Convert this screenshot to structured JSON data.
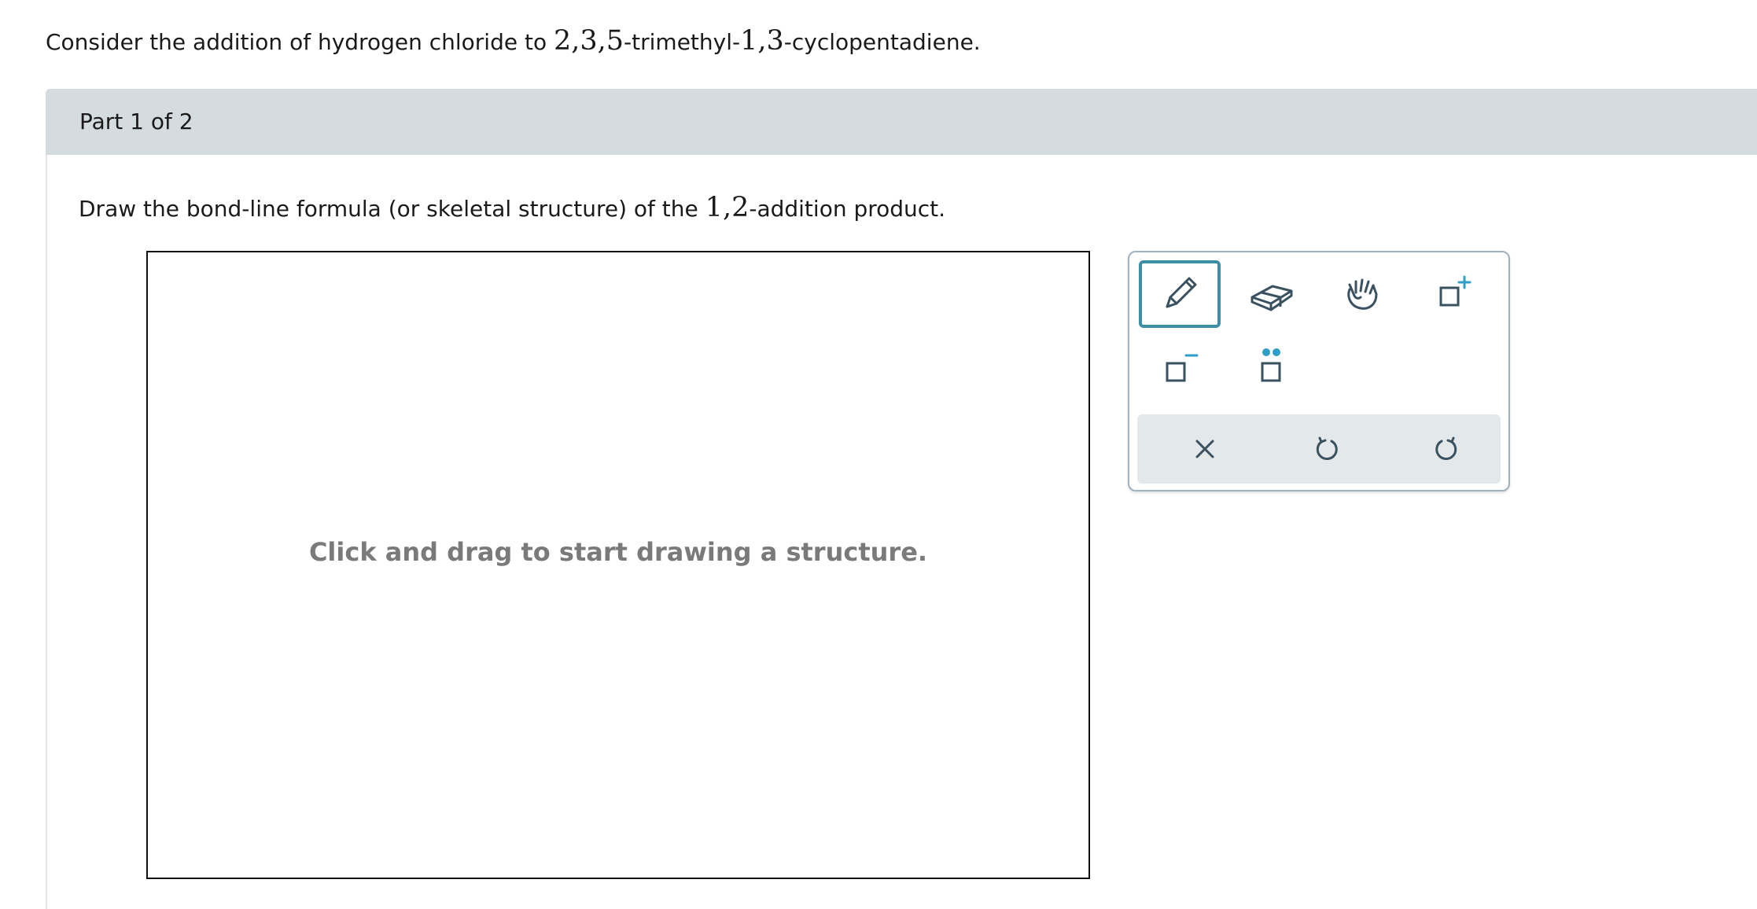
{
  "question": {
    "prefix": "Consider the addition of hydrogen chloride to ",
    "num1": "2,3,5",
    "middle": "-trimethyl-",
    "num2": "1,3",
    "suffix": "-cyclopentadiene."
  },
  "part": {
    "label": "Part 1 of 2"
  },
  "instruction": {
    "prefix": "Draw the bond-line formula (or skeletal structure) of the ",
    "num": "1,2",
    "suffix": "-addition product."
  },
  "canvas": {
    "hint": "Click and drag to start drawing a structure."
  },
  "toolbar": {
    "selected_tool": "pencil",
    "tools": [
      "pencil-icon",
      "eraser-icon",
      "hand-icon",
      "positive-charge-icon",
      "negative-charge-icon",
      "lone-pair-icon"
    ],
    "actions": [
      "clear-icon",
      "undo-icon",
      "redo-icon"
    ],
    "colors": {
      "icon": "#3a5160",
      "accent": "#3d8fa6",
      "charge": "#2f9ec9"
    }
  }
}
